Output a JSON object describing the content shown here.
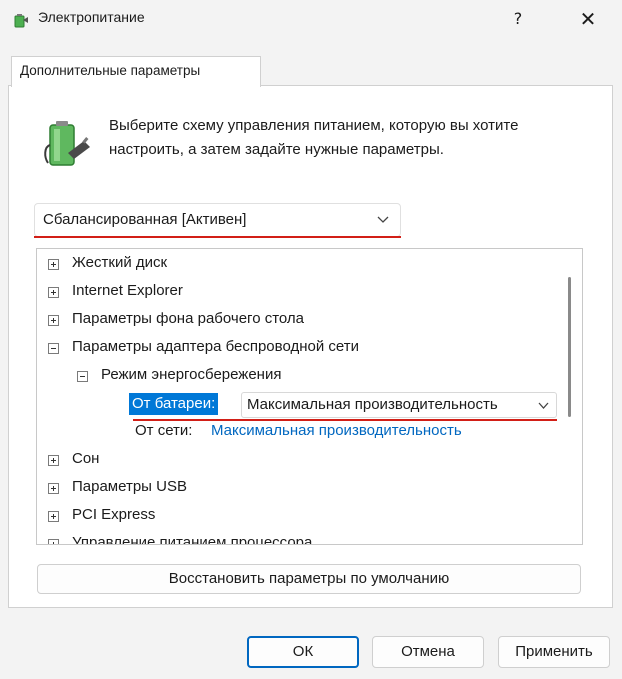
{
  "window": {
    "title": "Электропитание",
    "help_label": "?",
    "close_label": "✕"
  },
  "tab": {
    "label": "Дополнительные параметры"
  },
  "description": "Выберите схему управления питанием, которую вы хотите настроить, а затем задайте нужные параметры.",
  "scheme": {
    "selected": "Сбалансированная [Активен]"
  },
  "tree": {
    "items": [
      {
        "label": "Жесткий диск",
        "state": "collapsed"
      },
      {
        "label": "Internet Explorer",
        "state": "collapsed"
      },
      {
        "label": "Параметры фона рабочего стола",
        "state": "collapsed"
      },
      {
        "label": "Параметры адаптера беспроводной сети",
        "state": "expanded"
      },
      {
        "label": "Режим энергосбережения",
        "state": "expanded"
      },
      {
        "label": "Сон",
        "state": "collapsed"
      },
      {
        "label": "Параметры USB",
        "state": "collapsed"
      },
      {
        "label": "PCI Express",
        "state": "collapsed"
      },
      {
        "label": "Управление питанием процессора",
        "state": "collapsed"
      }
    ],
    "battery": {
      "label": "От батареи:",
      "value": "Максимальная производительность"
    },
    "ac": {
      "label": "От сети:",
      "value": "Максимальная производительность"
    }
  },
  "buttons": {
    "restore": "Восстановить параметры по умолчанию",
    "ok": "ОК",
    "cancel": "Отмена",
    "apply": "Применить"
  },
  "colors": {
    "accent": "#0078d7",
    "link": "#0067c0",
    "highlight_line": "#d21f17"
  }
}
